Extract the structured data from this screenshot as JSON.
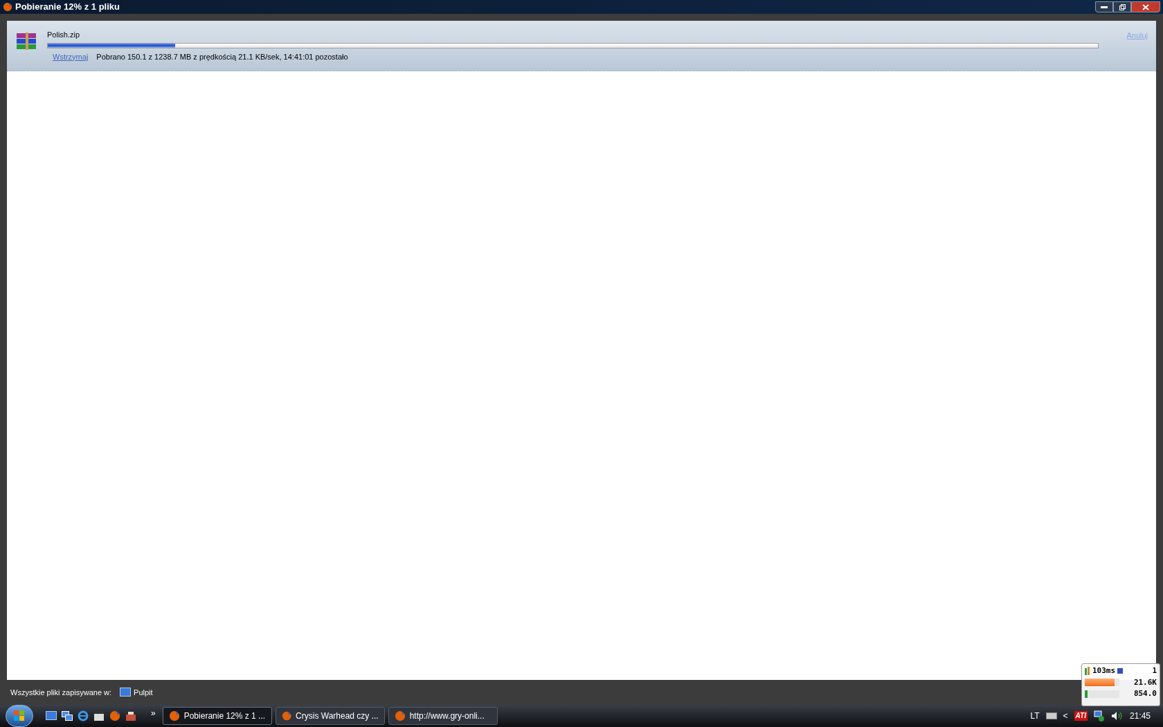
{
  "window": {
    "title": "Pobieranie 12% z 1 pliku"
  },
  "downloads": [
    {
      "name": "Polish.zip",
      "level": 0.121,
      "pause": "Wstrzymaj",
      "status": "Pobrano 150.1 z 1238.7 MB z prędkością 21.1 KB/sek, 14:41:01 pozostało",
      "cancel": "Anuluj"
    }
  ],
  "footer": {
    "label": "Wszystkie pliki zapisywane w:",
    "folder": "Pulpit"
  },
  "taskbar": {
    "more": "»",
    "tasks": [
      {
        "label": "Pobieranie 12% z 1 ...",
        "selected": true
      },
      {
        "label": "Crysis Warhead czy ...",
        "selected": false
      },
      {
        "label": "http://www.gry-onli...",
        "selected": false
      }
    ],
    "tray": {
      "language": "LT",
      "chevron": "<",
      "ati": "ATI",
      "clock": "21:45"
    }
  },
  "net_meter": {
    "ping": "103ms",
    "count": "1",
    "upload": {
      "reading": "21.6K",
      "level": 0.85
    },
    "download": {
      "reading": "854.0",
      "level": 0.08
    }
  }
}
